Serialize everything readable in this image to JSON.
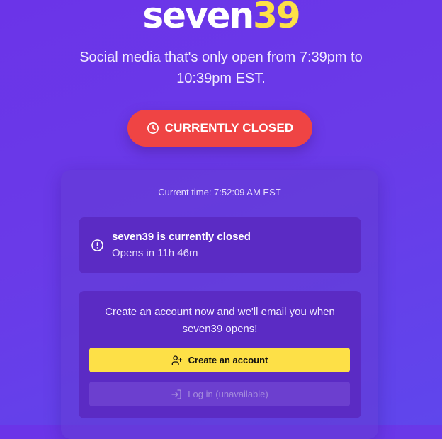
{
  "logo": {
    "word": "seven",
    "number": "39"
  },
  "tagline": "Social media that's only open from 7:39pm to 10:39pm EST.",
  "status": {
    "label": "CURRENTLY CLOSED",
    "icon": "clock-icon",
    "color": "#ef4444"
  },
  "clock": {
    "text": "Current time: 7:52:09 AM EST"
  },
  "closed_notice": {
    "icon": "info-icon",
    "title": "seven39 is currently closed",
    "subtitle": "Opens in 11h 46m"
  },
  "signup": {
    "message": "Create an account now and we'll email you when seven39 opens!",
    "create_label": "Create an account",
    "create_icon": "user-plus-icon",
    "login_label": "Log in (unavailable)",
    "login_icon": "log-in-icon"
  },
  "colors": {
    "background": "#6a3ae8",
    "accent": "#fde047",
    "card": "#5b2bc4"
  }
}
